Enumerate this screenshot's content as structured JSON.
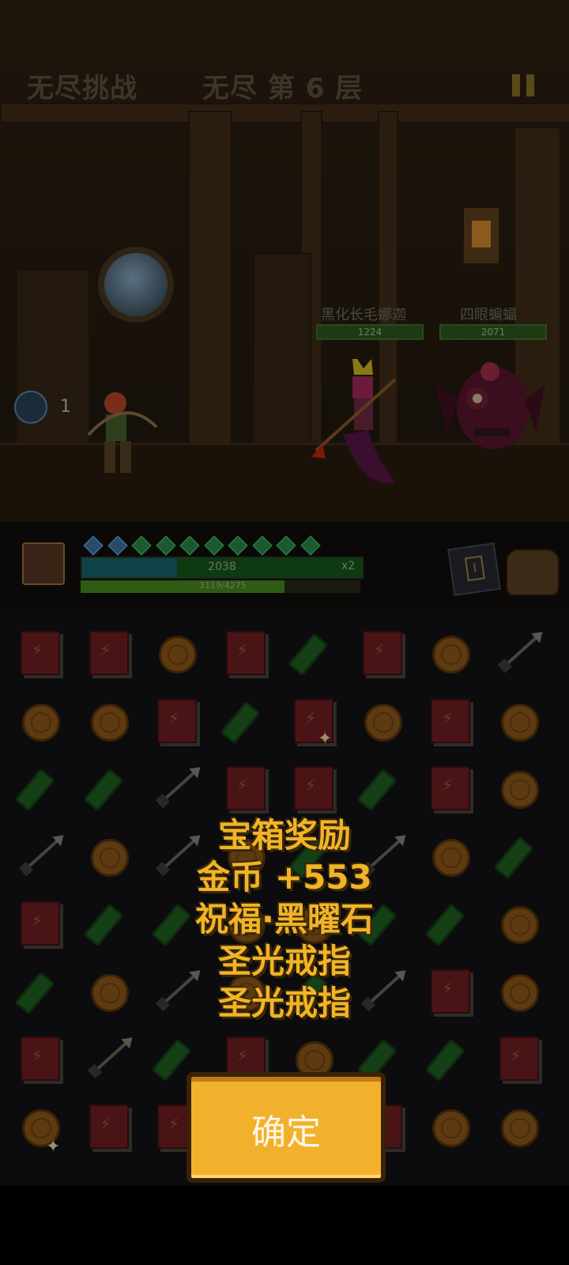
{
  "top_bar": {
    "mode_label": "无尽挑战",
    "floor_prefix": "无尽 第",
    "floor_number": "6",
    "floor_suffix": "层",
    "pause_icon": "pause-icon"
  },
  "scene": {
    "player_buff_count": "1",
    "enemies": [
      {
        "name": "黑化长毛娜迦",
        "hp": "1224"
      },
      {
        "name": "四眼蝙蝠",
        "hp": "2071"
      }
    ]
  },
  "hud": {
    "energy_gems": {
      "blue": 2,
      "green": 8
    },
    "hp_text": "2038",
    "hp_fraction": 0.34,
    "multiplier": "x2",
    "exp_text": "3119/4275",
    "exp_fraction": 0.73,
    "inventory_icons": [
      "spellbook-icon",
      "bag-icon"
    ]
  },
  "board": {
    "rows": [
      [
        "book",
        "book",
        "coin",
        "book",
        "potion",
        "book",
        "coin",
        "arrow"
      ],
      [
        "coin",
        "coin",
        "book",
        "potion",
        "book",
        "coin",
        "book",
        "coin"
      ],
      [
        "potion",
        "potion",
        "arrow",
        "book",
        "book",
        "potion",
        "book",
        "coin"
      ],
      [
        "arrow",
        "coin",
        "arrow",
        "coin",
        "potion",
        "arrow",
        "coin",
        "potion"
      ],
      [
        "book",
        "potion",
        "potion",
        "coin",
        "coin",
        "potion",
        "potion",
        "coin"
      ],
      [
        "potion",
        "coin",
        "arrow",
        "coin",
        "potion",
        "arrow",
        "book",
        "coin"
      ],
      [
        "book",
        "arrow",
        "potion",
        "book",
        "coin",
        "potion",
        "potion",
        "book"
      ],
      [
        "coin",
        "book",
        "book",
        "coin",
        "coin",
        "book",
        "coin",
        "coin"
      ]
    ]
  },
  "reward_dialog": {
    "title": "宝箱奖励",
    "lines": [
      "金币 +553",
      "祝福·黑曜石",
      "圣光戒指",
      "圣光戒指"
    ],
    "confirm_label": "确定"
  },
  "colors": {
    "reward_text": "#f0b426",
    "confirm_button": "#f2b12c"
  }
}
